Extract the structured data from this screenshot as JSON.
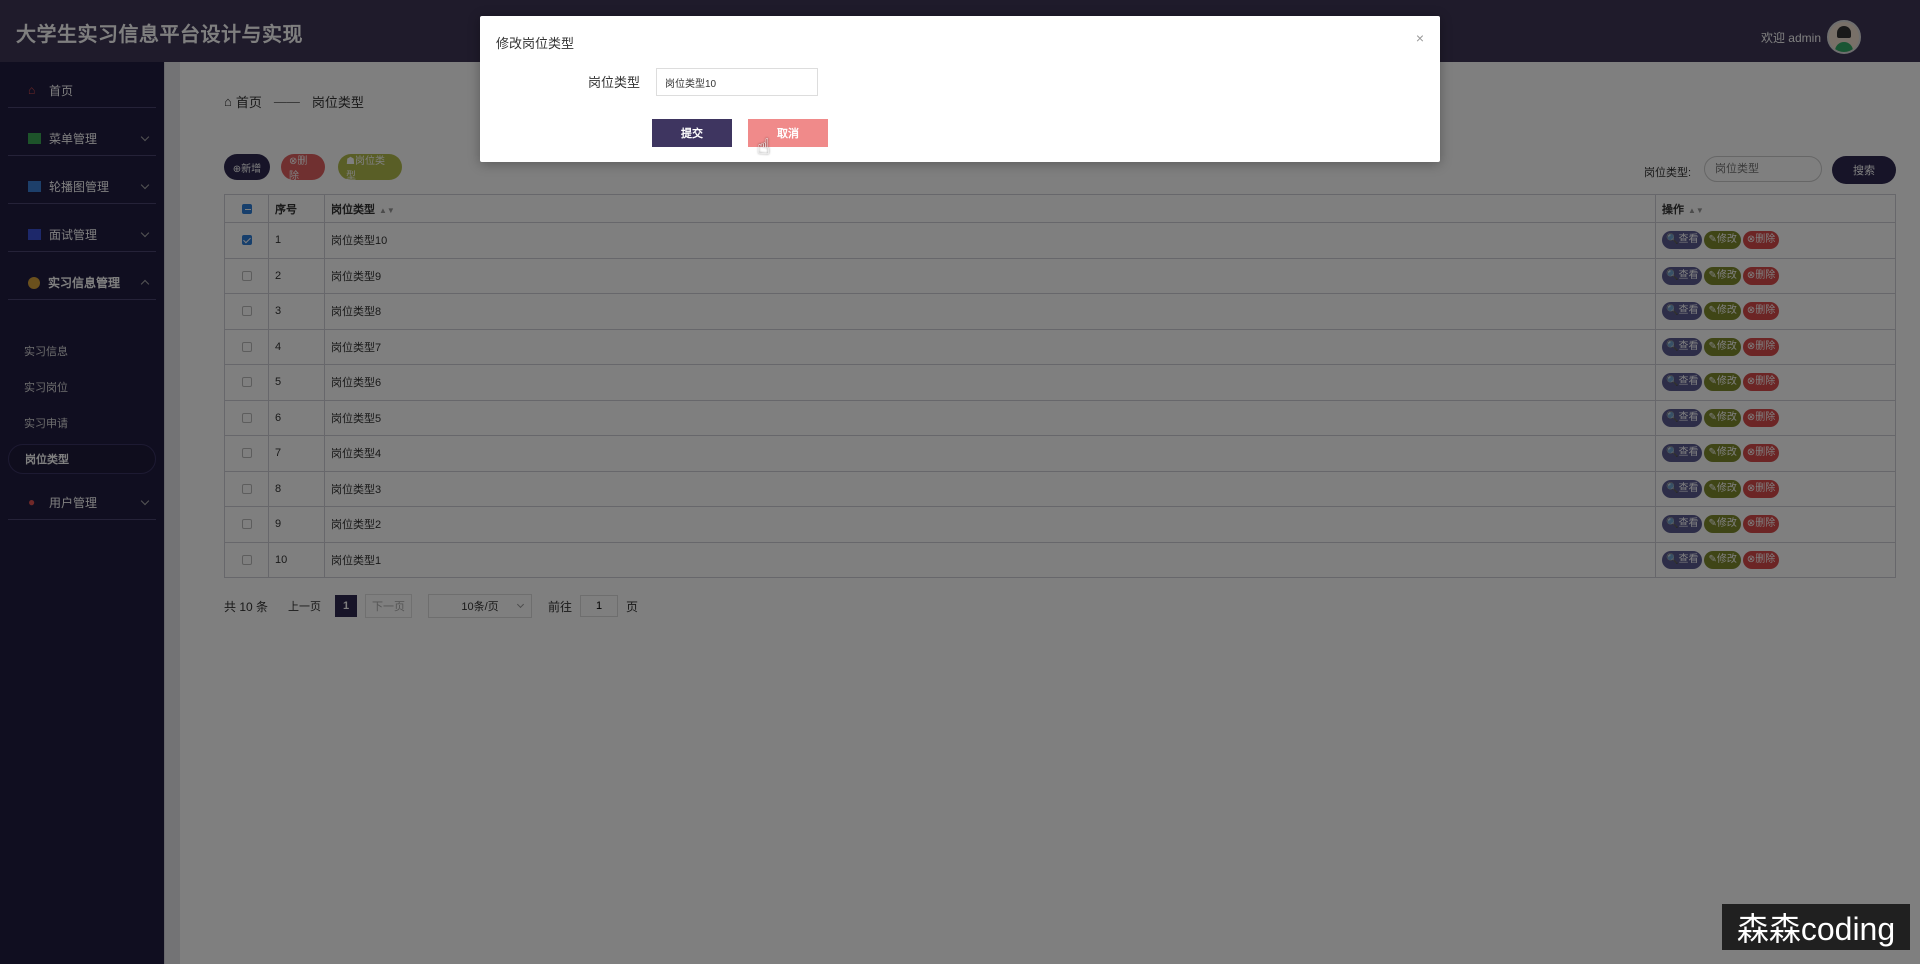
{
  "header": {
    "title": "大学生实习信息平台设计与实现",
    "welcome_text": "欢迎 admin"
  },
  "sidebar": {
    "items": [
      {
        "label": "首页",
        "icon": "home-icon",
        "color": "#e05050"
      },
      {
        "label": "菜单管理",
        "icon": "menu-icon",
        "color": "#3aa655"
      },
      {
        "label": "轮播图管理",
        "icon": "carousel-icon",
        "color": "#3a7fd5"
      },
      {
        "label": "面试管理",
        "icon": "interview-icon",
        "color": "#3a50d5"
      },
      {
        "label": "实习信息管理",
        "icon": "internship-icon",
        "color": "#d5a03a"
      }
    ],
    "sub_items": [
      {
        "label": "实习信息"
      },
      {
        "label": "实习岗位"
      },
      {
        "label": "实习申请"
      },
      {
        "label": "岗位类型"
      }
    ],
    "user_mgmt": {
      "label": "用户管理",
      "icon": "user-icon",
      "color": "#e05050"
    }
  },
  "breadcrumb": {
    "home": "首页",
    "separator": "——",
    "current": "岗位类型"
  },
  "toolbar": {
    "add_label": "⊕新增",
    "delete_label": "⊗删除",
    "type_label": "☗岗位类型"
  },
  "search": {
    "label": "岗位类型:",
    "placeholder": "岗位类型",
    "button_label": "搜索"
  },
  "table": {
    "columns": [
      "序号",
      "岗位类型",
      "操作"
    ],
    "rows": [
      {
        "no": "1",
        "type": "岗位类型10",
        "checked": true
      },
      {
        "no": "2",
        "type": "岗位类型9",
        "checked": false
      },
      {
        "no": "3",
        "type": "岗位类型8",
        "checked": false
      },
      {
        "no": "4",
        "type": "岗位类型7",
        "checked": false
      },
      {
        "no": "5",
        "type": "岗位类型6",
        "checked": false
      },
      {
        "no": "6",
        "type": "岗位类型5",
        "checked": false
      },
      {
        "no": "7",
        "type": "岗位类型4",
        "checked": false
      },
      {
        "no": "8",
        "type": "岗位类型3",
        "checked": false
      },
      {
        "no": "9",
        "type": "岗位类型2",
        "checked": false
      },
      {
        "no": "10",
        "type": "岗位类型1",
        "checked": false
      }
    ],
    "op_labels": {
      "view": "🔍查看",
      "edit": "✎修改",
      "delete": "⊗删除"
    }
  },
  "pagination": {
    "total": "共 10 条",
    "prev": "上一页",
    "current": "1",
    "next": "下一页",
    "page_size": "10条/页",
    "goto_label": "前往",
    "goto_value": "1",
    "page_unit": "页"
  },
  "dialog": {
    "title": "修改岗位类型",
    "close": "×",
    "field_label": "岗位类型",
    "field_value": "岗位类型10",
    "submit_label": "提交",
    "cancel_label": "取消"
  },
  "watermark": "森森coding"
}
